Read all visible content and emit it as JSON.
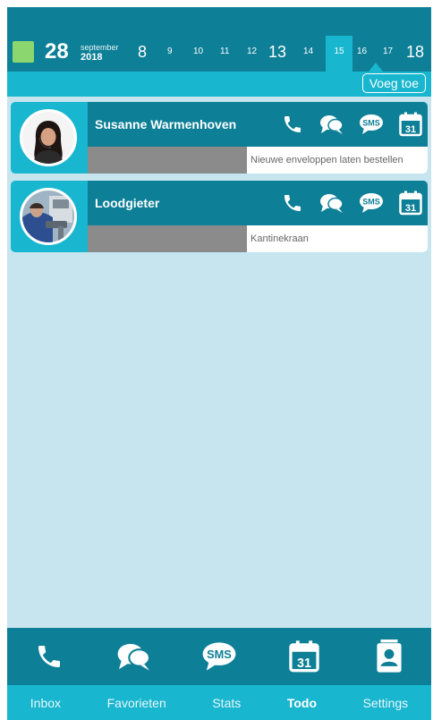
{
  "datebar": {
    "current_day": "28",
    "month": "september",
    "year": "2018",
    "days": [
      "8",
      "9",
      "10",
      "11",
      "12",
      "13",
      "14",
      "15",
      "16",
      "17",
      "18"
    ],
    "selected_day": "15",
    "swatch_color": "#8cd66f"
  },
  "actionbar": {
    "add_label": "Voeg toe"
  },
  "contacts": [
    {
      "name": "Susanne Warmenhoven",
      "note": "Nieuwe enveloppen laten bestellen"
    },
    {
      "name": "Loodgieter",
      "note": "Kantinekraan"
    }
  ],
  "card_icons": [
    "phone-icon",
    "chat-icon",
    "sms-icon",
    "calendar-icon"
  ],
  "calendar_number": "31",
  "sms_text": "SMS",
  "nav_icons": [
    "phone-icon",
    "chat-icon",
    "sms-icon",
    "calendar-icon",
    "contact-card-icon"
  ],
  "nav": {
    "items": [
      "Inbox",
      "Favorieten",
      "Stats",
      "Todo",
      "Settings"
    ],
    "active": "Todo"
  },
  "colors": {
    "dark_teal": "#0d7f96",
    "accent_cyan": "#19b6cf",
    "background": "#c6e5ef"
  }
}
